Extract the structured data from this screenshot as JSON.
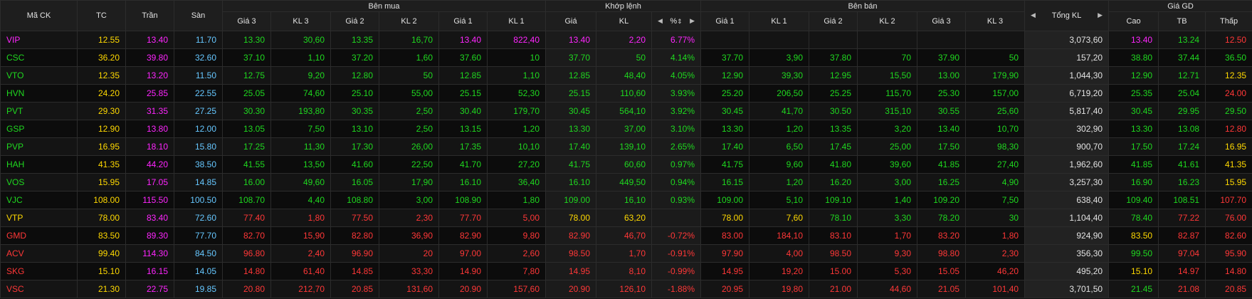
{
  "colors": {
    "ce": "#ff25ff",
    "fl": "#66c7ff",
    "up": "#1fd81f",
    "dn": "#ff3737",
    "ref": "#ffd900",
    "nt": "#e2e2e2"
  },
  "header": {
    "ma_ck": "Mã CK",
    "tc": "TC",
    "tran": "Trần",
    "san": "Sàn",
    "ben_mua": "Bên mua",
    "khop_lenh": "Khớp lệnh",
    "ben_ban": "Bên bán",
    "tong_kl": "Tổng KL",
    "gia_gd": "Giá GD",
    "bid_cols": [
      "Giá 3",
      "KL 3",
      "Giá 2",
      "KL 2",
      "Giá 1",
      "KL 1"
    ],
    "match_cols": [
      "Giá",
      "KL",
      "%"
    ],
    "ask_cols": [
      "Giá 1",
      "KL 1",
      "Giá 2",
      "KL 2",
      "Giá 3",
      "KL 3"
    ],
    "price_cols": [
      "Cao",
      "TB",
      "Thấp"
    ]
  },
  "rows": [
    {
      "sym": "VIP",
      "sym_c": "ce",
      "tc": "12.55",
      "tran": "13.40",
      "san": "11.70",
      "b": [
        [
          "13.30",
          "up"
        ],
        [
          "30,60",
          "up"
        ],
        [
          "13.35",
          "up"
        ],
        [
          "16,70",
          "up"
        ],
        [
          "13.40",
          "ce"
        ],
        [
          "822,40",
          "ce"
        ]
      ],
      "m": [
        [
          "13.40",
          "ce"
        ],
        [
          "2,20",
          "ce"
        ],
        [
          "6.77%",
          "ce"
        ]
      ],
      "a": [
        [
          "",
          ""
        ],
        [
          "",
          ""
        ],
        [
          "",
          ""
        ],
        [
          "",
          ""
        ],
        [
          "",
          ""
        ],
        [
          "",
          ""
        ]
      ],
      "total": "3,073,60",
      "p": [
        [
          "13.40",
          "ce"
        ],
        [
          "13.24",
          "up"
        ],
        [
          "12.50",
          "dn"
        ]
      ]
    },
    {
      "sym": "CSC",
      "sym_c": "up",
      "tc": "36.20",
      "tran": "39.80",
      "san": "32.60",
      "b": [
        [
          "37.10",
          "up"
        ],
        [
          "1,10",
          "up"
        ],
        [
          "37.20",
          "up"
        ],
        [
          "1,60",
          "up"
        ],
        [
          "37.60",
          "up"
        ],
        [
          "10",
          "up"
        ]
      ],
      "m": [
        [
          "37.70",
          "up"
        ],
        [
          "50",
          "up"
        ],
        [
          "4.14%",
          "up"
        ]
      ],
      "a": [
        [
          "37.70",
          "up"
        ],
        [
          "3,90",
          "up"
        ],
        [
          "37.80",
          "up"
        ],
        [
          "70",
          "up"
        ],
        [
          "37.90",
          "up"
        ],
        [
          "50",
          "up"
        ]
      ],
      "total": "157,20",
      "p": [
        [
          "38.80",
          "up"
        ],
        [
          "37.44",
          "up"
        ],
        [
          "36.50",
          "up"
        ]
      ]
    },
    {
      "sym": "VTO",
      "sym_c": "up",
      "tc": "12.35",
      "tran": "13.20",
      "san": "11.50",
      "b": [
        [
          "12.75",
          "up"
        ],
        [
          "9,20",
          "up"
        ],
        [
          "12.80",
          "up"
        ],
        [
          "50",
          "up"
        ],
        [
          "12.85",
          "up"
        ],
        [
          "1,10",
          "up"
        ]
      ],
      "m": [
        [
          "12.85",
          "up"
        ],
        [
          "48,40",
          "up"
        ],
        [
          "4.05%",
          "up"
        ]
      ],
      "a": [
        [
          "12.90",
          "up"
        ],
        [
          "39,30",
          "up"
        ],
        [
          "12.95",
          "up"
        ],
        [
          "15,50",
          "up"
        ],
        [
          "13.00",
          "up"
        ],
        [
          "179,90",
          "up"
        ]
      ],
      "total": "1,044,30",
      "p": [
        [
          "12.90",
          "up"
        ],
        [
          "12.71",
          "up"
        ],
        [
          "12.35",
          "ref"
        ]
      ]
    },
    {
      "sym": "HVN",
      "sym_c": "up",
      "tc": "24.20",
      "tran": "25.85",
      "san": "22.55",
      "b": [
        [
          "25.05",
          "up"
        ],
        [
          "74,60",
          "up"
        ],
        [
          "25.10",
          "up"
        ],
        [
          "55,00",
          "up"
        ],
        [
          "25.15",
          "up"
        ],
        [
          "52,30",
          "up"
        ]
      ],
      "m": [
        [
          "25.15",
          "up"
        ],
        [
          "110,60",
          "up"
        ],
        [
          "3.93%",
          "up"
        ]
      ],
      "a": [
        [
          "25.20",
          "up"
        ],
        [
          "206,50",
          "up"
        ],
        [
          "25.25",
          "up"
        ],
        [
          "115,70",
          "up"
        ],
        [
          "25.30",
          "up"
        ],
        [
          "157,00",
          "up"
        ]
      ],
      "total": "6,719,20",
      "p": [
        [
          "25.35",
          "up"
        ],
        [
          "25.04",
          "up"
        ],
        [
          "24.00",
          "dn"
        ]
      ]
    },
    {
      "sym": "PVT",
      "sym_c": "up",
      "tc": "29.30",
      "tran": "31.35",
      "san": "27.25",
      "b": [
        [
          "30.30",
          "up"
        ],
        [
          "193,80",
          "up"
        ],
        [
          "30.35",
          "up"
        ],
        [
          "2,50",
          "up"
        ],
        [
          "30.40",
          "up"
        ],
        [
          "179,70",
          "up"
        ]
      ],
      "m": [
        [
          "30.45",
          "up"
        ],
        [
          "564,10",
          "up"
        ],
        [
          "3.92%",
          "up"
        ]
      ],
      "a": [
        [
          "30.45",
          "up"
        ],
        [
          "41,70",
          "up"
        ],
        [
          "30.50",
          "up"
        ],
        [
          "315,10",
          "up"
        ],
        [
          "30.55",
          "up"
        ],
        [
          "25,60",
          "up"
        ]
      ],
      "total": "5,817,40",
      "p": [
        [
          "30.45",
          "up"
        ],
        [
          "29.95",
          "up"
        ],
        [
          "29.50",
          "up"
        ]
      ]
    },
    {
      "sym": "GSP",
      "sym_c": "up",
      "tc": "12.90",
      "tran": "13.80",
      "san": "12.00",
      "b": [
        [
          "13.05",
          "up"
        ],
        [
          "7,50",
          "up"
        ],
        [
          "13.10",
          "up"
        ],
        [
          "2,50",
          "up"
        ],
        [
          "13.15",
          "up"
        ],
        [
          "1,20",
          "up"
        ]
      ],
      "m": [
        [
          "13.30",
          "up"
        ],
        [
          "37,00",
          "up"
        ],
        [
          "3.10%",
          "up"
        ]
      ],
      "a": [
        [
          "13.30",
          "up"
        ],
        [
          "1,20",
          "up"
        ],
        [
          "13.35",
          "up"
        ],
        [
          "3,20",
          "up"
        ],
        [
          "13.40",
          "up"
        ],
        [
          "10,70",
          "up"
        ]
      ],
      "total": "302,90",
      "p": [
        [
          "13.30",
          "up"
        ],
        [
          "13.08",
          "up"
        ],
        [
          "12.80",
          "dn"
        ]
      ]
    },
    {
      "sym": "PVP",
      "sym_c": "up",
      "tc": "16.95",
      "tran": "18.10",
      "san": "15.80",
      "b": [
        [
          "17.25",
          "up"
        ],
        [
          "11,30",
          "up"
        ],
        [
          "17.30",
          "up"
        ],
        [
          "26,00",
          "up"
        ],
        [
          "17.35",
          "up"
        ],
        [
          "10,10",
          "up"
        ]
      ],
      "m": [
        [
          "17.40",
          "up"
        ],
        [
          "139,10",
          "up"
        ],
        [
          "2.65%",
          "up"
        ]
      ],
      "a": [
        [
          "17.40",
          "up"
        ],
        [
          "6,50",
          "up"
        ],
        [
          "17.45",
          "up"
        ],
        [
          "25,00",
          "up"
        ],
        [
          "17.50",
          "up"
        ],
        [
          "98,30",
          "up"
        ]
      ],
      "total": "900,70",
      "p": [
        [
          "17.50",
          "up"
        ],
        [
          "17.24",
          "up"
        ],
        [
          "16.95",
          "ref"
        ]
      ]
    },
    {
      "sym": "HAH",
      "sym_c": "up",
      "tc": "41.35",
      "tran": "44.20",
      "san": "38.50",
      "b": [
        [
          "41.55",
          "up"
        ],
        [
          "13,50",
          "up"
        ],
        [
          "41.60",
          "up"
        ],
        [
          "22,50",
          "up"
        ],
        [
          "41.70",
          "up"
        ],
        [
          "27,20",
          "up"
        ]
      ],
      "m": [
        [
          "41.75",
          "up"
        ],
        [
          "60,60",
          "up"
        ],
        [
          "0.97%",
          "up"
        ]
      ],
      "a": [
        [
          "41.75",
          "up"
        ],
        [
          "9,60",
          "up"
        ],
        [
          "41.80",
          "up"
        ],
        [
          "39,60",
          "up"
        ],
        [
          "41.85",
          "up"
        ],
        [
          "27,40",
          "up"
        ]
      ],
      "total": "1,962,60",
      "p": [
        [
          "41.85",
          "up"
        ],
        [
          "41.61",
          "up"
        ],
        [
          "41.35",
          "ref"
        ]
      ]
    },
    {
      "sym": "VOS",
      "sym_c": "up",
      "tc": "15.95",
      "tran": "17.05",
      "san": "14.85",
      "b": [
        [
          "16.00",
          "up"
        ],
        [
          "49,60",
          "up"
        ],
        [
          "16.05",
          "up"
        ],
        [
          "17,90",
          "up"
        ],
        [
          "16.10",
          "up"
        ],
        [
          "36,40",
          "up"
        ]
      ],
      "m": [
        [
          "16.10",
          "up"
        ],
        [
          "449,50",
          "up"
        ],
        [
          "0.94%",
          "up"
        ]
      ],
      "a": [
        [
          "16.15",
          "up"
        ],
        [
          "1,20",
          "up"
        ],
        [
          "16.20",
          "up"
        ],
        [
          "3,00",
          "up"
        ],
        [
          "16.25",
          "up"
        ],
        [
          "4,90",
          "up"
        ]
      ],
      "total": "3,257,30",
      "p": [
        [
          "16.90",
          "up"
        ],
        [
          "16.23",
          "up"
        ],
        [
          "15.95",
          "ref"
        ]
      ]
    },
    {
      "sym": "VJC",
      "sym_c": "up",
      "tc": "108.00",
      "tran": "115.50",
      "san": "100.50",
      "b": [
        [
          "108.70",
          "up"
        ],
        [
          "4,40",
          "up"
        ],
        [
          "108.80",
          "up"
        ],
        [
          "3,00",
          "up"
        ],
        [
          "108.90",
          "up"
        ],
        [
          "1,80",
          "up"
        ]
      ],
      "m": [
        [
          "109.00",
          "up"
        ],
        [
          "16,10",
          "up"
        ],
        [
          "0.93%",
          "up"
        ]
      ],
      "a": [
        [
          "109.00",
          "up"
        ],
        [
          "5,10",
          "up"
        ],
        [
          "109.10",
          "up"
        ],
        [
          "1,40",
          "up"
        ],
        [
          "109.20",
          "up"
        ],
        [
          "7,50",
          "up"
        ]
      ],
      "total": "638,40",
      "p": [
        [
          "109.40",
          "up"
        ],
        [
          "108.51",
          "up"
        ],
        [
          "107.70",
          "dn"
        ]
      ]
    },
    {
      "sym": "VTP",
      "sym_c": "ref",
      "tc": "78.00",
      "tran": "83.40",
      "san": "72.60",
      "b": [
        [
          "77.40",
          "dn"
        ],
        [
          "1,80",
          "dn"
        ],
        [
          "77.50",
          "dn"
        ],
        [
          "2,30",
          "dn"
        ],
        [
          "77.70",
          "dn"
        ],
        [
          "5,00",
          "dn"
        ]
      ],
      "m": [
        [
          "78.00",
          "ref"
        ],
        [
          "63,20",
          "ref"
        ],
        [
          "",
          ""
        ]
      ],
      "a": [
        [
          "78.00",
          "ref"
        ],
        [
          "7,60",
          "ref"
        ],
        [
          "78.10",
          "up"
        ],
        [
          "3,30",
          "up"
        ],
        [
          "78.20",
          "up"
        ],
        [
          "30",
          "up"
        ]
      ],
      "total": "1,104,40",
      "p": [
        [
          "78.40",
          "up"
        ],
        [
          "77.22",
          "dn"
        ],
        [
          "76.00",
          "dn"
        ]
      ]
    },
    {
      "sym": "GMD",
      "sym_c": "dn",
      "tc": "83.50",
      "tran": "89.30",
      "san": "77.70",
      "b": [
        [
          "82.70",
          "dn"
        ],
        [
          "15,90",
          "dn"
        ],
        [
          "82.80",
          "dn"
        ],
        [
          "36,90",
          "dn"
        ],
        [
          "82.90",
          "dn"
        ],
        [
          "9,80",
          "dn"
        ]
      ],
      "m": [
        [
          "82.90",
          "dn"
        ],
        [
          "46,70",
          "dn"
        ],
        [
          "-0.72%",
          "dn"
        ]
      ],
      "a": [
        [
          "83.00",
          "dn"
        ],
        [
          "184,10",
          "dn"
        ],
        [
          "83.10",
          "dn"
        ],
        [
          "1,70",
          "dn"
        ],
        [
          "83.20",
          "dn"
        ],
        [
          "1,80",
          "dn"
        ]
      ],
      "total": "924,90",
      "p": [
        [
          "83.50",
          "ref"
        ],
        [
          "82.87",
          "dn"
        ],
        [
          "82.60",
          "dn"
        ]
      ]
    },
    {
      "sym": "ACV",
      "sym_c": "dn",
      "tc": "99.40",
      "tran": "114.30",
      "san": "84.50",
      "b": [
        [
          "96.80",
          "dn"
        ],
        [
          "2,40",
          "dn"
        ],
        [
          "96.90",
          "dn"
        ],
        [
          "20",
          "dn"
        ],
        [
          "97.00",
          "dn"
        ],
        [
          "2,60",
          "dn"
        ]
      ],
      "m": [
        [
          "98.50",
          "dn"
        ],
        [
          "1,70",
          "dn"
        ],
        [
          "-0.91%",
          "dn"
        ]
      ],
      "a": [
        [
          "97.90",
          "dn"
        ],
        [
          "4,00",
          "dn"
        ],
        [
          "98.50",
          "dn"
        ],
        [
          "9,30",
          "dn"
        ],
        [
          "98.80",
          "dn"
        ],
        [
          "2,30",
          "dn"
        ]
      ],
      "total": "356,30",
      "p": [
        [
          "99.50",
          "up"
        ],
        [
          "97.04",
          "dn"
        ],
        [
          "95.90",
          "dn"
        ]
      ]
    },
    {
      "sym": "SKG",
      "sym_c": "dn",
      "tc": "15.10",
      "tran": "16.15",
      "san": "14.05",
      "b": [
        [
          "14.80",
          "dn"
        ],
        [
          "61,40",
          "dn"
        ],
        [
          "14.85",
          "dn"
        ],
        [
          "33,30",
          "dn"
        ],
        [
          "14.90",
          "dn"
        ],
        [
          "7,80",
          "dn"
        ]
      ],
      "m": [
        [
          "14.95",
          "dn"
        ],
        [
          "8,10",
          "dn"
        ],
        [
          "-0.99%",
          "dn"
        ]
      ],
      "a": [
        [
          "14.95",
          "dn"
        ],
        [
          "19,20",
          "dn"
        ],
        [
          "15.00",
          "dn"
        ],
        [
          "5,30",
          "dn"
        ],
        [
          "15.05",
          "dn"
        ],
        [
          "46,20",
          "dn"
        ]
      ],
      "total": "495,20",
      "p": [
        [
          "15.10",
          "ref"
        ],
        [
          "14.97",
          "dn"
        ],
        [
          "14.80",
          "dn"
        ]
      ]
    },
    {
      "sym": "VSC",
      "sym_c": "dn",
      "tc": "21.30",
      "tran": "22.75",
      "san": "19.85",
      "b": [
        [
          "20.80",
          "dn"
        ],
        [
          "212,70",
          "dn"
        ],
        [
          "20.85",
          "dn"
        ],
        [
          "131,60",
          "dn"
        ],
        [
          "20.90",
          "dn"
        ],
        [
          "157,60",
          "dn"
        ]
      ],
      "m": [
        [
          "20.90",
          "dn"
        ],
        [
          "126,10",
          "dn"
        ],
        [
          "-1.88%",
          "dn"
        ]
      ],
      "a": [
        [
          "20.95",
          "dn"
        ],
        [
          "19,80",
          "dn"
        ],
        [
          "21.00",
          "dn"
        ],
        [
          "44,60",
          "dn"
        ],
        [
          "21.05",
          "dn"
        ],
        [
          "101,40",
          "dn"
        ]
      ],
      "total": "3,701,50",
      "p": [
        [
          "21.45",
          "up"
        ],
        [
          "21.08",
          "dn"
        ],
        [
          "20.85",
          "dn"
        ]
      ]
    }
  ]
}
